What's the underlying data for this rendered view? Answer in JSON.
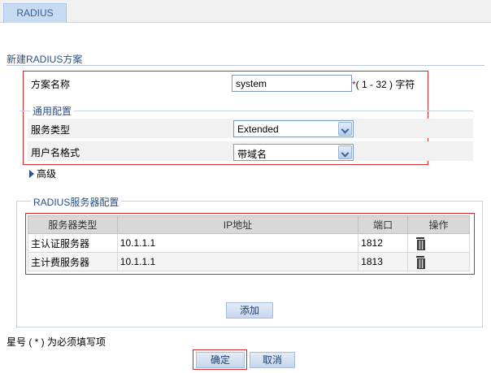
{
  "tab": {
    "label": "RADIUS"
  },
  "page_title": "新建RADIUS方案",
  "scheme_name": {
    "label": "方案名称",
    "value": "system",
    "required_mark": "*",
    "hint": "( 1 - 32 ) 字符"
  },
  "general_config": {
    "legend": "通用配置",
    "service_type": {
      "label": "服务类型",
      "selected": "Extended"
    },
    "username_format": {
      "label": "用户名格式",
      "selected": "带域名"
    }
  },
  "advanced": {
    "label": "高级"
  },
  "server_config": {
    "legend": "RADIUS服务器配置",
    "columns": [
      "服务器类型",
      "IP地址",
      "端口",
      "操作"
    ],
    "rows": [
      {
        "type": "主认证服务器",
        "ip": "10.1.1.1",
        "port": "1812",
        "action_icon": "trash-icon"
      },
      {
        "type": "主计费服务器",
        "ip": "10.1.1.1",
        "port": "1813",
        "action_icon": "trash-icon"
      }
    ],
    "add_label": "添加"
  },
  "footnote": "星号 ( * ) 为必须填写项",
  "buttons": {
    "confirm": "确定",
    "cancel": "取消"
  },
  "colors": {
    "highlight_border": "#d12b2b",
    "section_title": "#2b4f84",
    "tab_bg": "#c7dbf3"
  }
}
